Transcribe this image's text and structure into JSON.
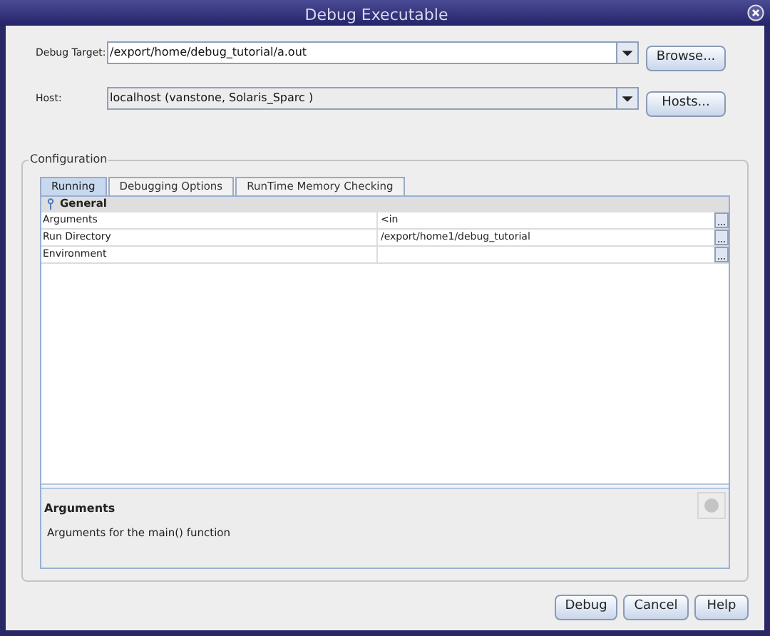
{
  "window": {
    "title": "Debug Executable"
  },
  "fields": [
    {
      "label": "Debug Target:",
      "value": "/export/home/debug_tutorial/a.out",
      "editable": true,
      "button": "Browse..."
    },
    {
      "label": "Host:",
      "value": "localhost (vanstone, Solaris_Sparc )",
      "editable": false,
      "button": "Hosts..."
    }
  ],
  "configuration": {
    "title": "Configuration",
    "tabs": [
      {
        "label": "Running",
        "selected": true
      },
      {
        "label": "Debugging Options",
        "selected": false
      },
      {
        "label": "RunTime Memory Checking",
        "selected": false
      }
    ],
    "section": "General",
    "properties": [
      {
        "name": "Arguments",
        "value": "<in"
      },
      {
        "name": "Run Directory",
        "value": "/export/home1/debug_tutorial"
      },
      {
        "name": "Environment"
      }
    ],
    "description": {
      "title": "Arguments",
      "text": "Arguments for the main() function"
    }
  },
  "buttons": [
    "Debug",
    "Cancel",
    "Help"
  ]
}
